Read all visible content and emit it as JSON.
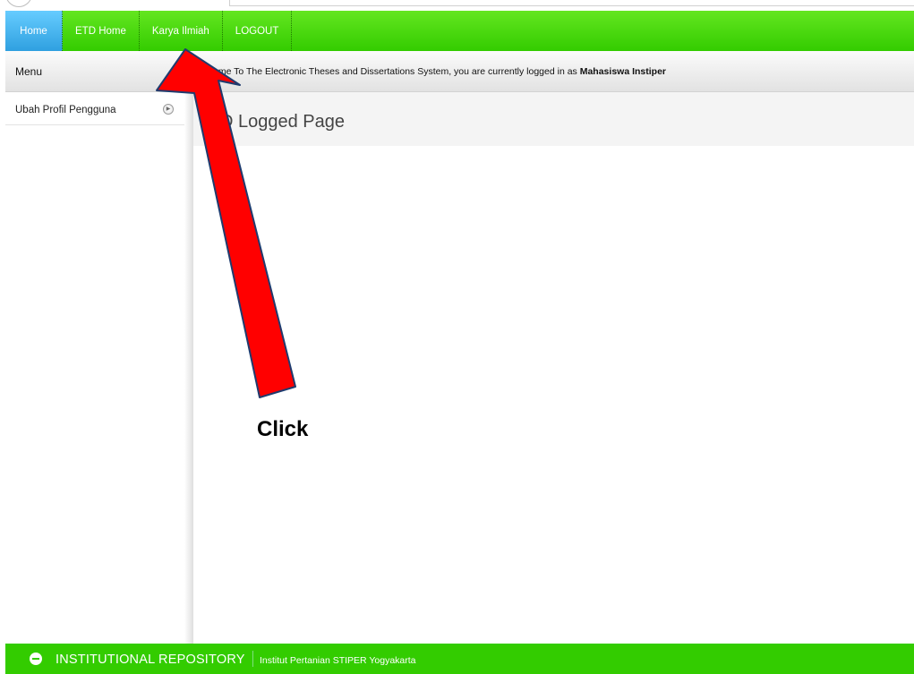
{
  "nav": {
    "items": [
      {
        "label": "Home",
        "active": true
      },
      {
        "label": "ETD Home",
        "active": false
      },
      {
        "label": "Karya Ilmiah",
        "active": false
      },
      {
        "label": "LOGOUT",
        "active": false
      }
    ]
  },
  "subbar": {
    "menu_label": "Menu",
    "welcome_prefix": "ome To The Electronic Theses and Dissertations System, you are currently logged in as ",
    "welcome_user": "Mahasiswa Instiper"
  },
  "sidebar": {
    "items": [
      {
        "label": "Ubah Profil Pengguna"
      }
    ]
  },
  "content": {
    "title": "D Logged Page"
  },
  "annotation": {
    "click_text": "Click",
    "arrow_color": "#ff0000"
  },
  "footer": {
    "repo_name": "INSTITUTIONAL REPOSITORY",
    "institution": "Institut Pertanian STIPER Yogyakarta"
  },
  "colors": {
    "nav_green": "#33cc00",
    "active_blue": "#2fa0e0",
    "footer_green": "#33cc00"
  }
}
